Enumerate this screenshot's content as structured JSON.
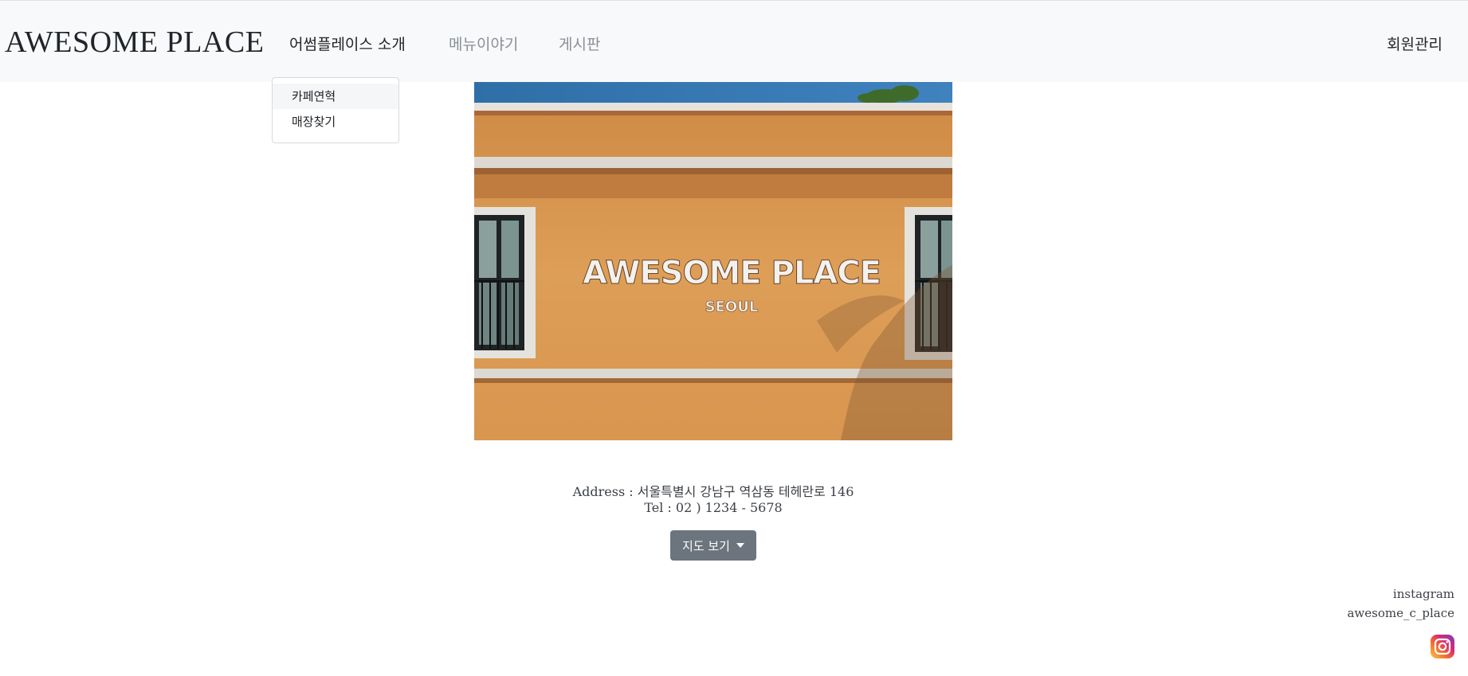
{
  "header": {
    "brand": "AWESOME PLACE",
    "nav": {
      "intro": "어썸플레이스 소개",
      "menu": "메뉴이야기",
      "board": "게시판",
      "member": "회원관리"
    }
  },
  "dropdown": {
    "items": [
      "카페연혁",
      "매장찾기"
    ]
  },
  "hero": {
    "sign_title": "AWESOME PLACE",
    "sign_sub": "SEOUL"
  },
  "info": {
    "address": "Address : 서울특별시 강남구 역삼동 테헤란로 146",
    "tel": "Tel : 02 ) 1234 - 5678"
  },
  "map_button": {
    "label": "지도 보기"
  },
  "footer": {
    "instagram_label": "instagram",
    "instagram_handle": "awesome_c_place"
  },
  "icons": {
    "caret": "caret-down-icon",
    "instagram": "instagram-icon"
  },
  "colors": {
    "navbar_bg": "#f8f9fa",
    "button_bg": "#6c757d",
    "wall": "#d8964f"
  }
}
